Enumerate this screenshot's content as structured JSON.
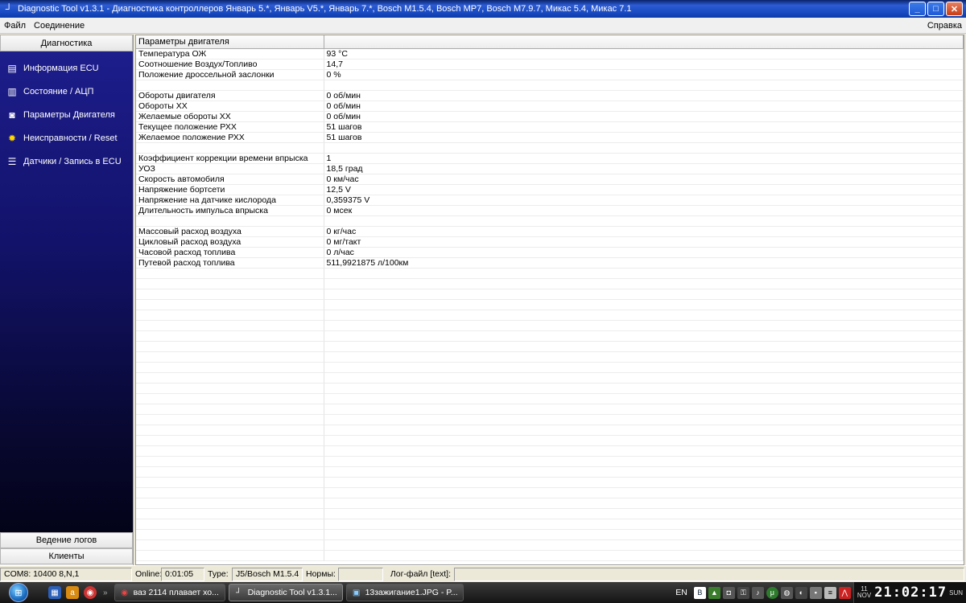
{
  "window": {
    "title": "Diagnostic Tool v1.3.1 - Диагностика контроллеров Январь 5.*, Январь V5.*, Январь 7.*, Bosch M1.5.4, Bosch MP7, Bosch M7.9.7, Микас 5.4, Микас 7.1",
    "min_label": "_",
    "max_label": "□",
    "close_label": "✕"
  },
  "menu": {
    "file": "Файл",
    "connection": "Соединение",
    "help": "Справка"
  },
  "sidebar": {
    "header": "Диагностика",
    "items": [
      {
        "label": "Информация ECU",
        "icon": "ecu-info-icon"
      },
      {
        "label": "Состояние / АЦП",
        "icon": "adc-state-icon"
      },
      {
        "label": "Параметры Двигателя",
        "icon": "engine-params-icon"
      },
      {
        "label": "Неисправности / Reset",
        "icon": "faults-icon"
      },
      {
        "label": "Датчики / Запись в ECU",
        "icon": "sensors-icon"
      }
    ],
    "logs": "Ведение логов",
    "clients": "Клиенты"
  },
  "grid": {
    "col1_header": "Параметры двигателя",
    "col2_header": "",
    "rows": [
      [
        "Температура ОЖ",
        "93 °C"
      ],
      [
        "Соотношение Воздух/Топливо",
        "14,7"
      ],
      [
        "Положение дроссельной заслонки",
        "0 %"
      ],
      [
        "",
        ""
      ],
      [
        "Обороты двигателя",
        "0 об/мин"
      ],
      [
        "Обороты ХХ",
        "0 об/мин"
      ],
      [
        "Желаемые обороты ХХ",
        "0 об/мин"
      ],
      [
        "Текущее положение РХХ",
        "51 шагов"
      ],
      [
        "Желаемое положение РХХ",
        "51 шагов"
      ],
      [
        "",
        ""
      ],
      [
        "Коэффициент коррекции времени впрыска",
        "1"
      ],
      [
        "УОЗ",
        "18,5 град"
      ],
      [
        "Скорость автомобиля",
        "0 км/час"
      ],
      [
        "Напряжение бортсети",
        "12,5 V"
      ],
      [
        "Напряжение на датчике кислорода",
        "0,359375 V"
      ],
      [
        "Длительность импульса впрыска",
        "0 мсек"
      ],
      [
        "",
        ""
      ],
      [
        "Массовый расход воздуха",
        "0 кг/час"
      ],
      [
        "Цикловый расход воздуха",
        "0 мг/такт"
      ],
      [
        "Часовой расход топлива",
        "0 л/час"
      ],
      [
        "Путевой расход топлива",
        "511,9921875 л/100км"
      ]
    ]
  },
  "status": {
    "port": "COM8: 10400 8,N,1",
    "online_label": "Online:",
    "online_value": "0:01:05",
    "type_label": "Type:",
    "type_value": "J5/Bosch M1.5.4",
    "norms_label": "Нормы:",
    "norms_value": "",
    "logfile_label": "Лог-файл [text]:",
    "logfile_value": ""
  },
  "taskbar": {
    "windows": [
      {
        "label": "ваз 2114 плавает хо...",
        "icon": "chrome-icon"
      },
      {
        "label": "Diagnostic Tool v1.3.1...",
        "icon": "diagnostic-tool-icon"
      },
      {
        "label": "13зажигание1.JPG - P...",
        "icon": "paint-icon"
      }
    ],
    "lang": "EN",
    "clock_day": "11",
    "clock_month": "NOV",
    "clock_time": "21:02:17",
    "clock_dow": "SUN"
  }
}
